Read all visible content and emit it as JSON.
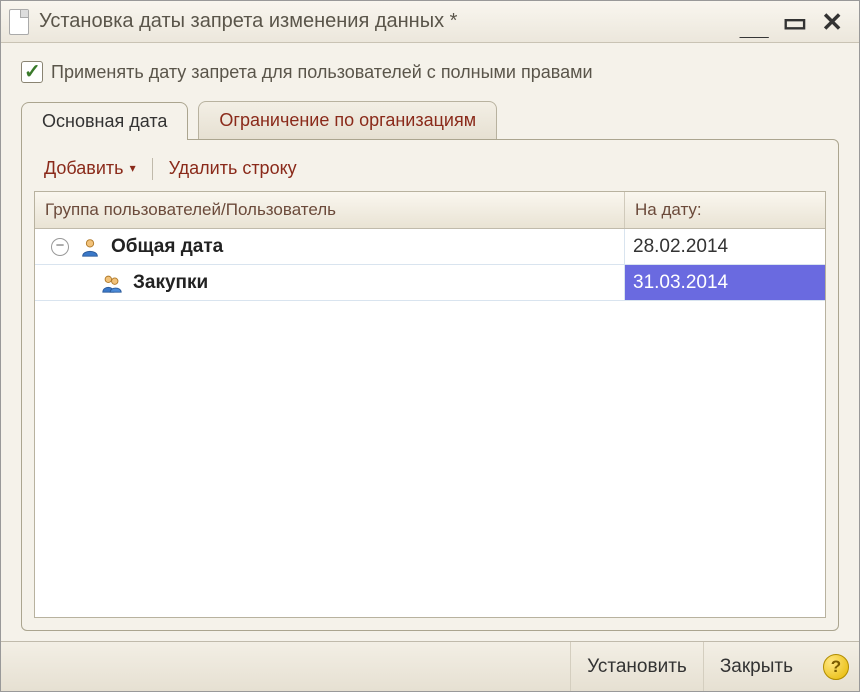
{
  "window": {
    "title": "Установка даты запрета изменения данных  *"
  },
  "checkbox": {
    "label": "Применять дату запрета для пользователей с полными правами",
    "checked": true
  },
  "tabs": [
    {
      "label": "Основная дата",
      "active": true
    },
    {
      "label": "Ограничение по организациям",
      "active": false
    }
  ],
  "toolbar": {
    "add": "Добавить",
    "delete_row": "Удалить строку"
  },
  "table": {
    "columns": {
      "group_user": "Группа пользователей/Пользователь",
      "date": "На дату:"
    },
    "rows": [
      {
        "label": "Общая дата",
        "date": "28.02.2014",
        "level": 0,
        "icon": "user-single",
        "expander": "minus",
        "selected": false
      },
      {
        "label": "Закупки",
        "date": "31.03.2014",
        "level": 1,
        "icon": "user-group",
        "expander": null,
        "selected": true
      }
    ]
  },
  "footer": {
    "apply": "Установить",
    "close": "Закрыть"
  }
}
